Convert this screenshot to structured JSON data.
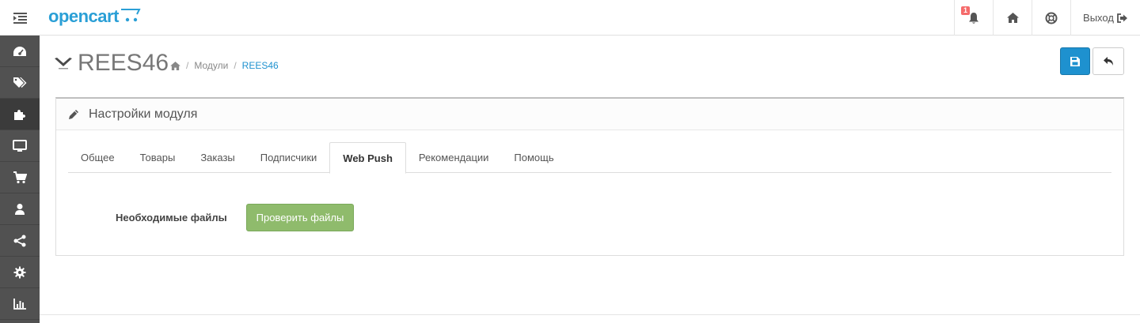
{
  "header": {
    "logo_text": "opencart",
    "notification_count": "1",
    "logout_label": "Выход"
  },
  "sidebar": {
    "items": [
      {
        "icon": "dashboard-icon"
      },
      {
        "icon": "tags-icon"
      },
      {
        "icon": "puzzle-icon",
        "active": true
      },
      {
        "icon": "desktop-icon"
      },
      {
        "icon": "shopping-cart-icon"
      },
      {
        "icon": "user-icon"
      },
      {
        "icon": "share-icon"
      },
      {
        "icon": "cog-icon"
      },
      {
        "icon": "bar-chart-icon"
      }
    ]
  },
  "page": {
    "title": "REES46",
    "breadcrumb": {
      "modules": "Модули",
      "current": "REES46"
    }
  },
  "panel": {
    "title": "Настройки модуля",
    "tabs": [
      "Общее",
      "Товары",
      "Заказы",
      "Подписчики",
      "Web Push",
      "Рекомендации",
      "Помощь"
    ],
    "active_tab": "Web Push",
    "form": {
      "label": "Необходимые файлы",
      "button": "Проверить файлы"
    }
  },
  "colors": {
    "primary": "#1e91cf",
    "success": "#8fbb6c",
    "sidebar": "#515151"
  }
}
